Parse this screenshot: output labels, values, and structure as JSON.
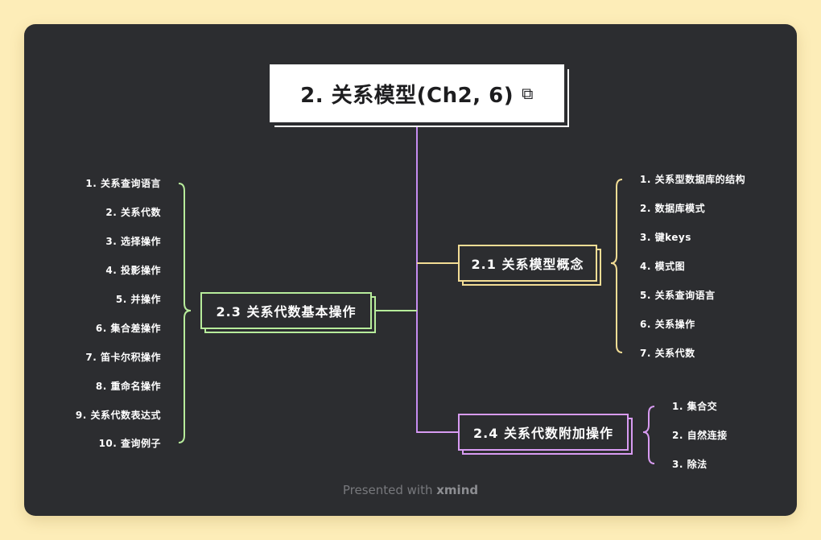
{
  "root": {
    "title": "2. 关系模型(Ch2, 6)",
    "link_icon": "⧉"
  },
  "topics": {
    "t21": {
      "label": "2.1 关系模型概念",
      "color": "#f3dd95"
    },
    "t23": {
      "label": "2.3 关系代数基本操作",
      "color": "#b7ec9b"
    },
    "t24": {
      "label": "2.4 关系代数附加操作",
      "color": "#d89bf2"
    }
  },
  "leaves": {
    "t21": [
      "1. 关系型数据库的结构",
      "2. 数据库模式",
      "3. 键keys",
      "4. 模式图",
      "5. 关系查询语言",
      "6. 关系操作",
      "7. 关系代数"
    ],
    "t23": [
      "1. 关系查询语言",
      "2. 关系代数",
      "3. 选择操作",
      "4. 投影操作",
      "5. 并操作",
      "6. 集合差操作",
      "7. 笛卡尔积操作",
      "8. 重命名操作",
      "9. 关系代数表达式",
      "10. 查询例子"
    ],
    "t24": [
      "1. 集合交",
      "2. 自然连接",
      "3. 除法"
    ]
  },
  "footer": {
    "prefix": "Presented with ",
    "brand": "xmind"
  },
  "colors": {
    "canvas": "#2c2d30",
    "background": "#fdedb8",
    "trunk": "#c58cf0"
  }
}
